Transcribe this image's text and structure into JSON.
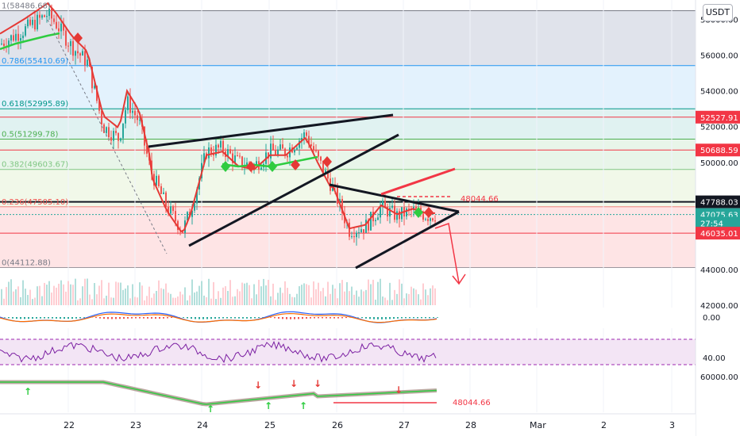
{
  "currency_label": "USDT",
  "price_axis": {
    "ticks": [
      "58000.00",
      "56000.00",
      "54000.00",
      "52000.00",
      "50000.00",
      "48000.00",
      "46000.00",
      "44000.00",
      "42000.00"
    ],
    "badges": [
      {
        "label": "52527.91",
        "price": 52527.91,
        "color": "#f23645",
        "text_color": "#ffffff"
      },
      {
        "label": "50688.59",
        "price": 50688.59,
        "color": "#f23645",
        "text_color": "#ffffff"
      },
      {
        "label": "47788.03",
        "price": 47788.03,
        "color": "#131722",
        "text_color": "#ffffff"
      },
      {
        "label": "47075.63",
        "price": 47075.63,
        "color": "#26a69a",
        "text_color": "#ffffff"
      },
      {
        "label": "27:54",
        "price": 46600,
        "color": "#26a69a",
        "text_color": "#ffffff"
      },
      {
        "label": "46035.01",
        "price": 46035.01,
        "color": "#f23645",
        "text_color": "#ffffff"
      }
    ]
  },
  "fib_levels": [
    {
      "label": "1(58486.68)",
      "price": 58486.68,
      "zone_color": "#e0e3eb",
      "line_color": "#787b86"
    },
    {
      "label": "0.786(55410.69)",
      "price": 55410.69,
      "zone_color": "#e3f2fd",
      "line_color": "#2196f3"
    },
    {
      "label": "0.618(52995.89)",
      "price": 52995.89,
      "zone_color": "#e0f2f1",
      "line_color": "#009688"
    },
    {
      "label": "0.5(51299.78)",
      "price": 51299.78,
      "zone_color": "#e8f5e9",
      "line_color": "#4caf50"
    },
    {
      "label": "0.382(49603.67)",
      "price": 49603.67,
      "zone_color": "#f1f8e9",
      "line_color": "#81c784"
    },
    {
      "label": "0.236(47505.10)",
      "price": 47505.1,
      "zone_color": "#ffebee",
      "line_color": "#ef5350"
    },
    {
      "label": "0(44112.88)",
      "price": 44112.88,
      "zone_color": "#ffcdd2",
      "line_color": "#787b86"
    }
  ],
  "resistance_label": "48044.66",
  "indicators": {
    "macd_tick": "0.00",
    "rsi_tick": "40.00",
    "third_tick": "60000.00",
    "third_value_label": "48044.66"
  },
  "time_axis": [
    "22",
    "23",
    "24",
    "25",
    "26",
    "27",
    "28",
    "Mar",
    "2",
    "3"
  ],
  "colors": {
    "bull": "#26a69a",
    "bear": "#ef5350",
    "ma_red": "#e53935",
    "ma_green": "#2ecc40",
    "trendline": "#131722",
    "projection": "#f23645",
    "rsi": "#7b1fa2"
  },
  "chart_data": {
    "type": "candlestick",
    "symbol_quote": "USDT",
    "ylim": [
      42000,
      60000
    ],
    "x_categories": [
      "22",
      "23",
      "24",
      "25",
      "26",
      "27",
      "28",
      "Mar",
      "2",
      "3"
    ],
    "high": 58486.68,
    "low": 44112.88,
    "last_price": 47075.63
  }
}
